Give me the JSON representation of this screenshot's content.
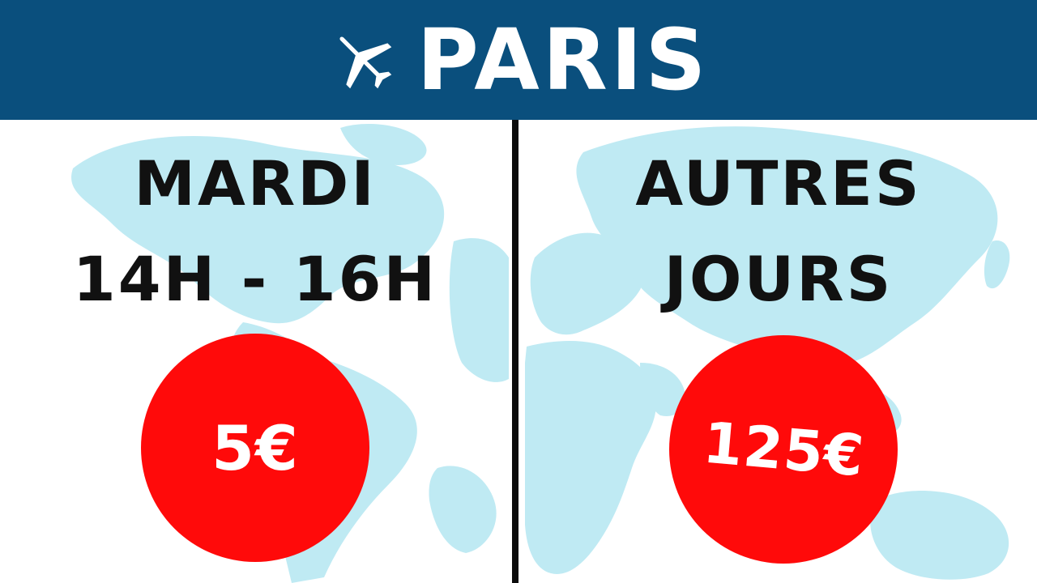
{
  "header": {
    "title": "PARIS",
    "icon": "airplane-icon",
    "background_color": "#0a4f7d"
  },
  "left_panel": {
    "line1": "MARDI",
    "line2": "14H - 16H",
    "price": "5€"
  },
  "right_panel": {
    "line1": "AUTRES",
    "line2": "JOURS",
    "price": "125€"
  },
  "colors": {
    "price_badge": "#ff0a0a",
    "map_land": "#bfeaf3",
    "divider": "#0b0b0b"
  }
}
